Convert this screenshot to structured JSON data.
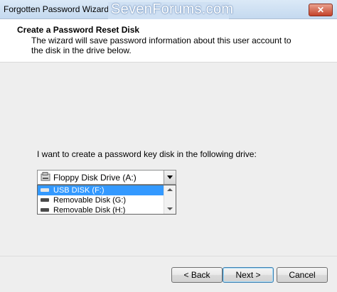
{
  "window": {
    "title": "Forgotten Password Wizard",
    "close_glyph": "✕"
  },
  "watermark": {
    "text": "SevenForums.com"
  },
  "header": {
    "title": "Create a Password Reset Disk",
    "description": "The wizard will save password information about this user account to the disk in the drive below."
  },
  "main": {
    "prompt": "I want to create a password key disk in the following drive:",
    "drive_select": {
      "selected": "Floppy Disk Drive (A:)",
      "selected_icon": "floppy-drive-icon",
      "options": [
        {
          "label": "USB DISK (F:)",
          "icon": "removable-drive-icon",
          "highlighted": true
        },
        {
          "label": "Removable Disk (G:)",
          "icon": "removable-drive-icon",
          "highlighted": false
        },
        {
          "label": "Removable Disk (H:)",
          "icon": "removable-drive-icon",
          "highlighted": false
        }
      ]
    }
  },
  "buttons": {
    "back": "< Back",
    "next": "Next >",
    "cancel": "Cancel"
  },
  "colors": {
    "highlight": "#3399ff",
    "close_button": "#c4432b",
    "titlebar": "#c4d9ef"
  }
}
